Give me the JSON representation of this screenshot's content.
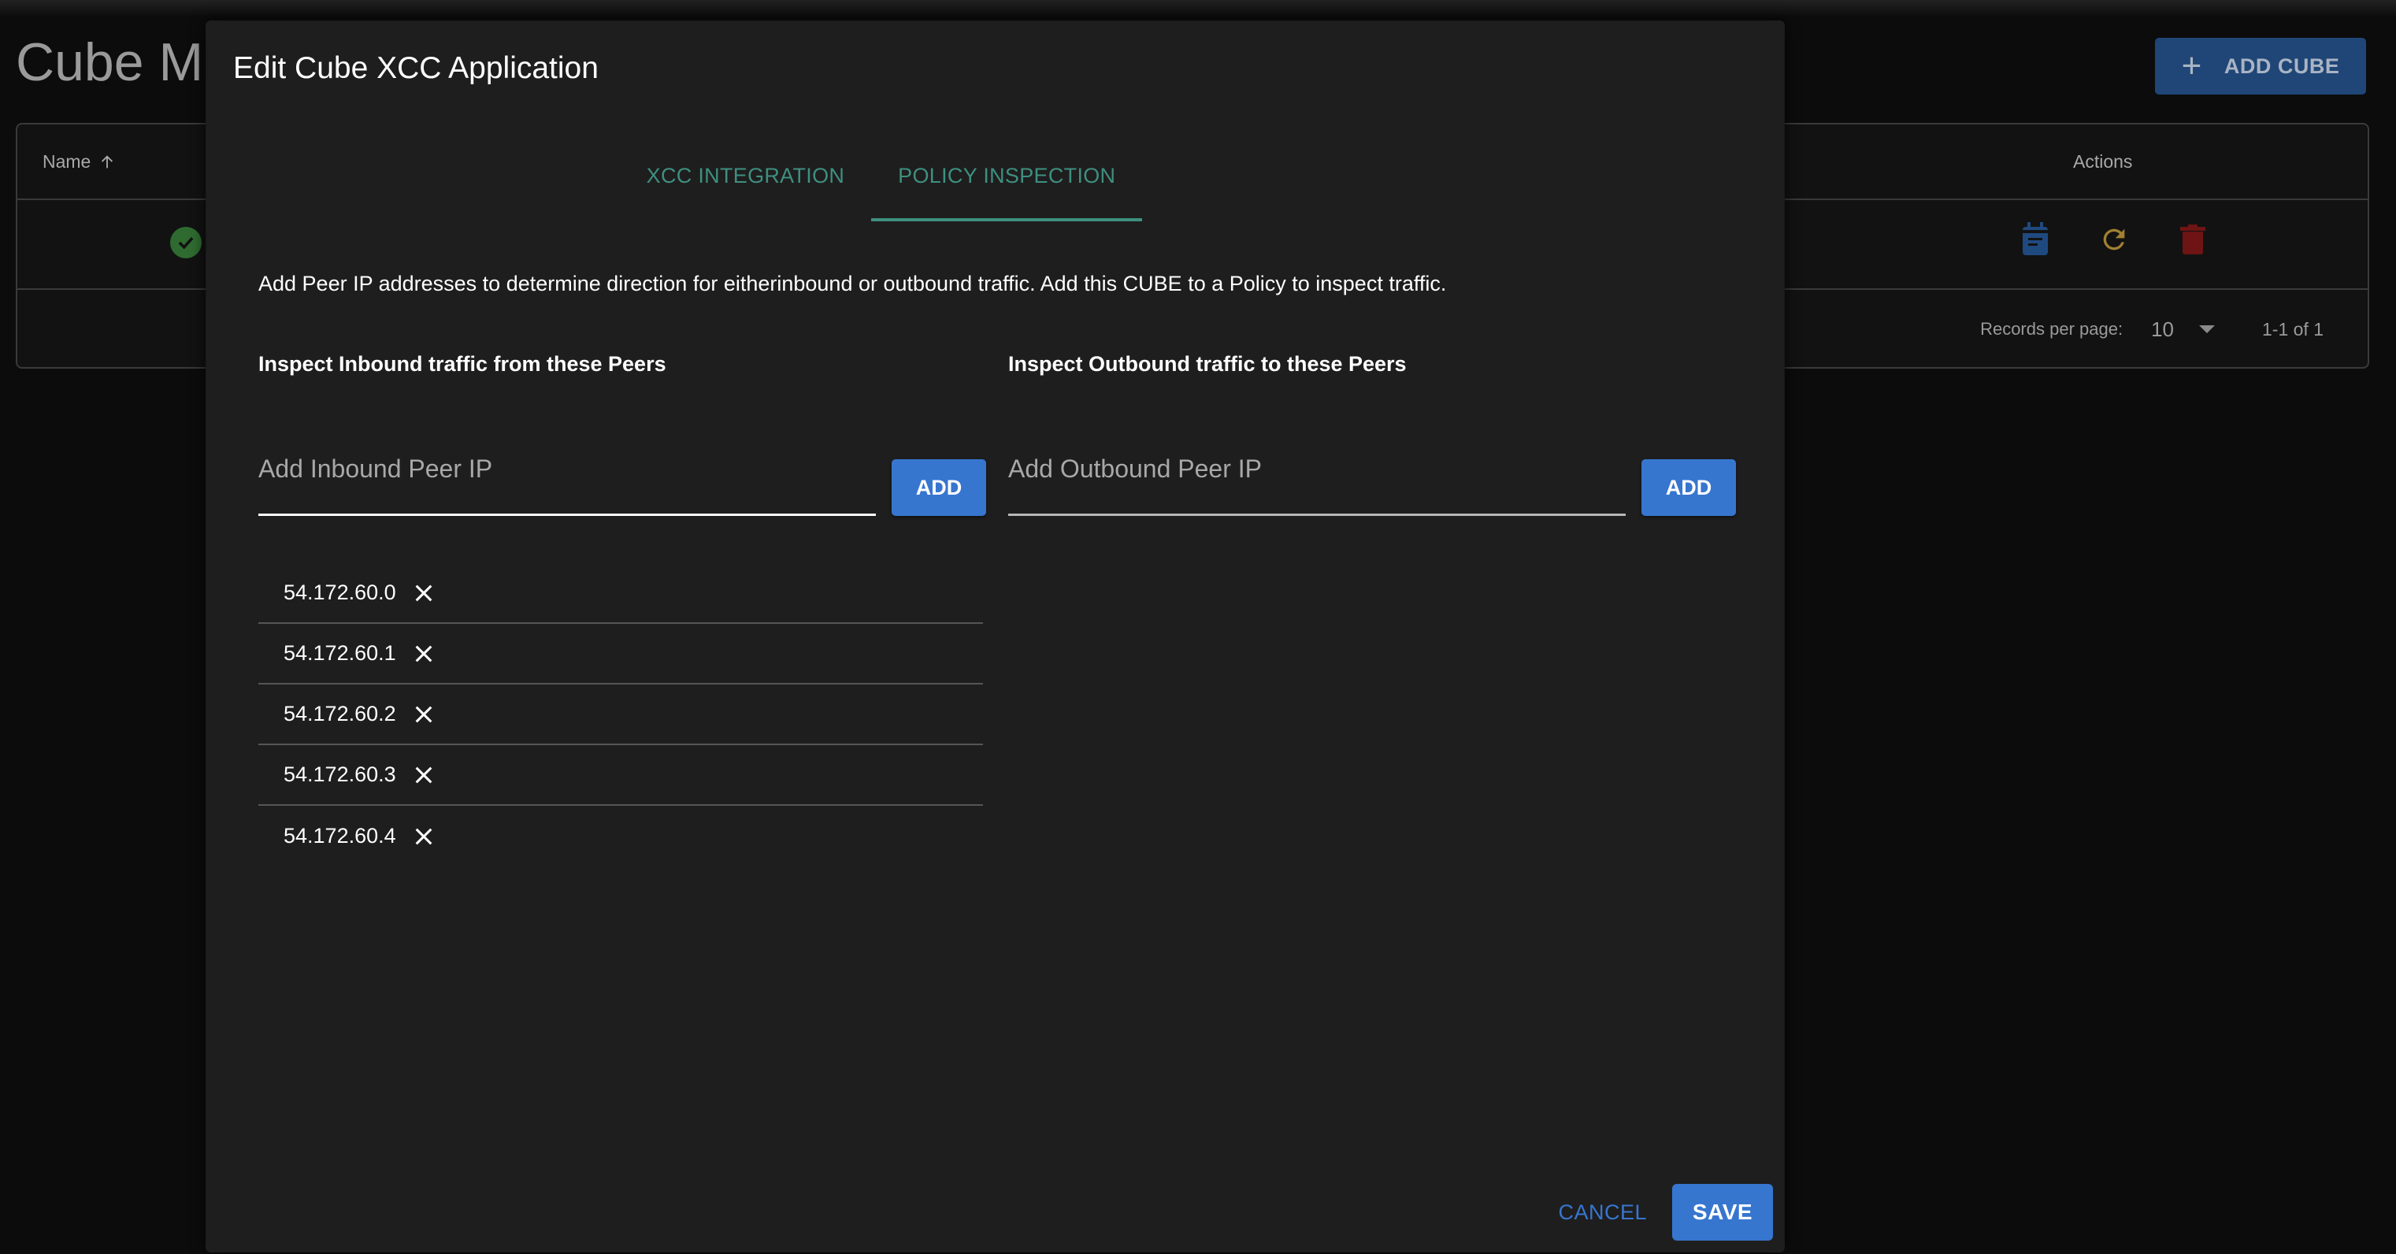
{
  "page": {
    "title": "Cube Ma",
    "add_button_label": "ADD CUBE",
    "table": {
      "columns": {
        "name": "Name",
        "actions": "Actions"
      },
      "rows": [
        {
          "status": "ok"
        }
      ],
      "footer": {
        "records_per_page_label": "Records per page:",
        "records_per_page_value": "10",
        "pagination": "1-1 of 1"
      }
    },
    "colors": {
      "edit_icon": "#1f4a80",
      "refresh_icon": "#a08030",
      "delete_icon": "#6e1414",
      "status_ok": "#2f6b30"
    }
  },
  "dialog": {
    "title": "Edit Cube XCC Application",
    "tabs": [
      {
        "label": "XCC INTEGRATION",
        "active": false
      },
      {
        "label": "POLICY INSPECTION",
        "active": true
      }
    ],
    "description": "Add Peer IP addresses to determine direction for eitherinbound or outbound traffic. Add this CUBE to a Policy to inspect traffic.",
    "inbound": {
      "heading": "Inspect Inbound traffic from these Peers",
      "placeholder": "Add Inbound Peer IP",
      "value": "",
      "add_label": "ADD",
      "peers": [
        "54.172.60.0",
        "54.172.60.1",
        "54.172.60.2",
        "54.172.60.3",
        "54.172.60.4"
      ]
    },
    "outbound": {
      "heading": "Inspect Outbound traffic to these Peers",
      "placeholder": "Add Outbound Peer IP",
      "value": "",
      "add_label": "ADD",
      "peers": []
    },
    "cancel_label": "CANCEL",
    "save_label": "SAVE",
    "colors": {
      "accent_tab": "#3f8f80",
      "primary": "#3776cf"
    }
  }
}
